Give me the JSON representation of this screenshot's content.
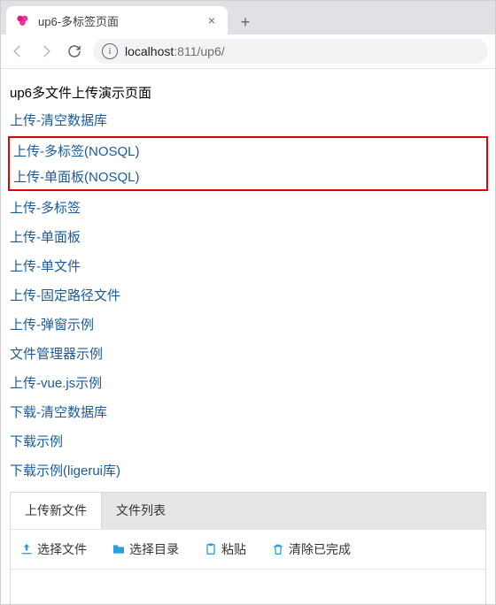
{
  "browser": {
    "tab_title": "up6-多标签页面",
    "url_host": "localhost",
    "url_port": ":811",
    "url_path": "/up6/"
  },
  "page": {
    "heading": "up6多文件上传演示页面",
    "links": [
      "上传-清空数据库",
      "上传-多标签(NOSQL)",
      "上传-单面板(NOSQL)",
      "上传-多标签",
      "上传-单面板",
      "上传-单文件",
      "上传-固定路径文件",
      "上传-弹窗示例",
      "文件管理器示例",
      "上传-vue.js示例",
      "下载-清空数据库",
      "下载示例",
      "下载示例(ligerui库)"
    ],
    "highlight_indices": [
      1,
      2
    ]
  },
  "upload_widget": {
    "tab_upload": "上传新文件",
    "tab_list": "文件列表",
    "act_select_file": "选择文件",
    "act_select_dir": "选择目录",
    "act_paste": "粘贴",
    "act_clear_done": "清除已完成"
  },
  "colors": {
    "upload_icon": "#29a0d8",
    "folder_icon": "#29a0d8",
    "paste_icon": "#29a0d8",
    "trash_icon": "#29a0d8"
  }
}
